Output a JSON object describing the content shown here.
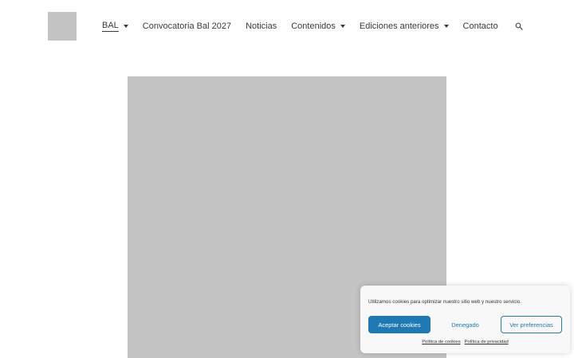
{
  "nav": {
    "items": [
      {
        "label": "BAL",
        "dropdown": true,
        "active": true
      },
      {
        "label": "Convocatoria Bal 2027",
        "dropdown": false
      },
      {
        "label": "Noticias",
        "dropdown": false
      },
      {
        "label": "Contenidos",
        "dropdown": true
      },
      {
        "label": "Ediciones anteriores",
        "dropdown": true
      },
      {
        "label": "Contacto",
        "dropdown": false
      }
    ]
  },
  "cookie_banner": {
    "message": "Utilizamos cookies para optimizar nuestro sitio web y nuestro servicio.",
    "accept_label": "Aceptar cookies",
    "deny_label": "Denegado",
    "preferences_label": "Ver preferencias",
    "cookie_policy_label": "Política de cookies",
    "privacy_policy_label": "Política de privacidad"
  },
  "colors": {
    "accent": "#1f79b5",
    "placeholder": "#c4c4c4",
    "text": "#3a3a3a"
  }
}
